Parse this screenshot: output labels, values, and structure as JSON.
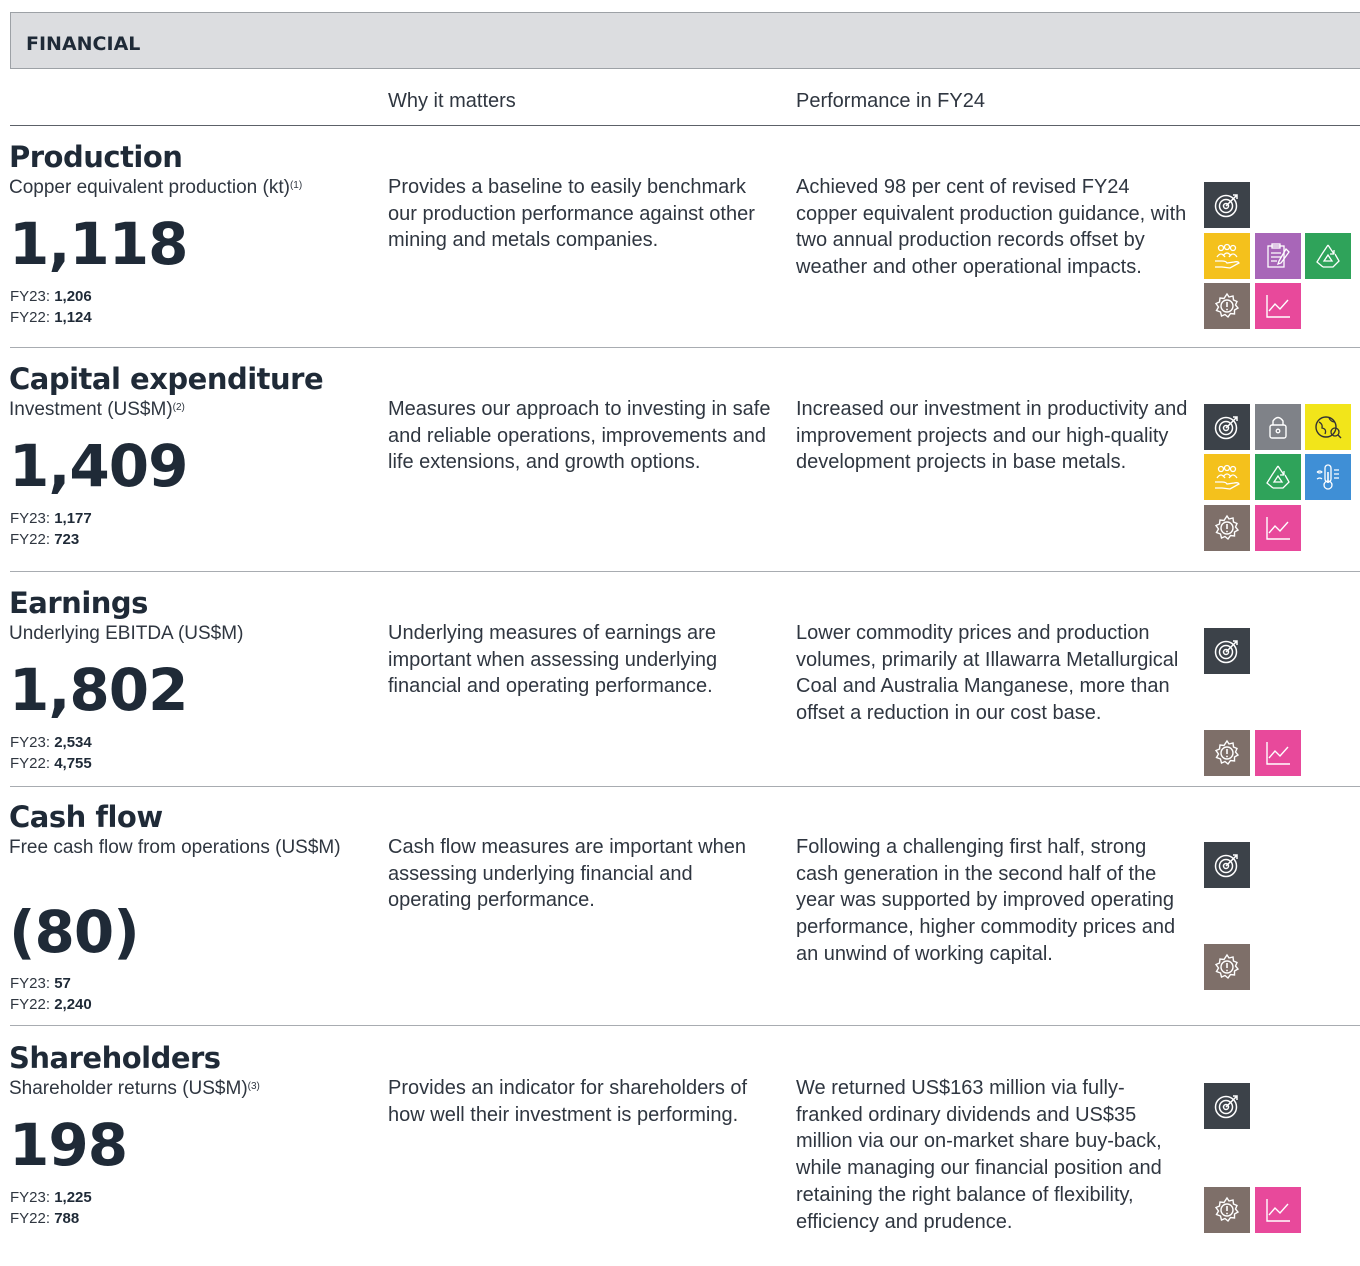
{
  "header": {
    "title": "FINANCIAL"
  },
  "columns": {
    "why": "Why it matters",
    "performance": "Performance in FY24"
  },
  "sections": [
    {
      "title": "Production",
      "metric": "Copper equivalent production (kt)",
      "metric_note": "(1)",
      "value": "1,118",
      "fy23_label": "FY23:",
      "fy23": "1,206",
      "fy22_label": "FY22:",
      "fy22": "1,124",
      "why": "Provides a baseline to easily benchmark our production performance against other mining and metals companies.",
      "performance": "Achieved 98 per cent of revised FY24 copper equivalent production guidance, with two annual production records offset by weather and other operational impacts.",
      "icons": [
        "target-icon",
        "people-icon",
        "clipboard-icon",
        "recycle-icon",
        "gear-alert-icon",
        "trend-chart-icon"
      ]
    },
    {
      "title": "Capital expenditure",
      "metric": "Investment (US$M)",
      "metric_note": "(2)",
      "value": "1,409",
      "fy23_label": "FY23:",
      "fy23": "1,177",
      "fy22_label": "FY22:",
      "fy22": "723",
      "why": "Measures our approach to investing in safe and reliable operations, improvements and life extensions, and growth options.",
      "performance": "Increased our investment in productivity and improvement projects and our high-quality development projects in base metals.",
      "icons": [
        "target-icon",
        "lock-icon",
        "globe-icon",
        "people-icon",
        "recycle-icon",
        "thermometer-icon",
        "gear-alert-icon",
        "trend-chart-icon"
      ]
    },
    {
      "title": "Earnings",
      "metric": "Underlying EBITDA (US$M)",
      "metric_note": "",
      "value": "1,802",
      "fy23_label": "FY23:",
      "fy23": "2,534",
      "fy22_label": "FY22:",
      "fy22": "4,755",
      "why": "Underlying measures of earnings are important when assessing underlying financial and operating performance.",
      "performance": "Lower commodity prices and production volumes, primarily at Illawarra Metallurgical Coal and Australia Manganese, more than offset a reduction in our cost base.",
      "icons": [
        "target-icon",
        "gear-alert-icon",
        "trend-chart-icon"
      ]
    },
    {
      "title": "Cash flow",
      "metric": "Free cash flow from operations (US$M)",
      "metric_note": "",
      "value": "(80)",
      "fy23_label": "FY23:",
      "fy23": "57",
      "fy22_label": "FY22:",
      "fy22": "2,240",
      "why": "Cash flow measures are important when assessing underlying financial and operating performance.",
      "performance": "Following a challenging first half, strong cash generation in the second half of the year was supported by improved operating performance, higher commodity prices and an unwind of working capital.",
      "icons": [
        "target-icon",
        "gear-alert-icon"
      ]
    },
    {
      "title": "Shareholders",
      "metric": "Shareholder returns (US$M)",
      "metric_note": "(3)",
      "value": "198",
      "fy23_label": "FY23:",
      "fy23": "1,225",
      "fy22_label": "FY22:",
      "fy22": "788",
      "why": "Provides an indicator for shareholders of how well their investment is performing.",
      "performance": "We returned US$163 million via fully-franked ordinary dividends and US$35 million via our on-market share buy-back, while managing our financial position and retaining the right balance of flexibility, efficiency and prudence.",
      "icons": [
        "target-icon",
        "gear-alert-icon",
        "trend-chart-icon"
      ]
    }
  ]
}
